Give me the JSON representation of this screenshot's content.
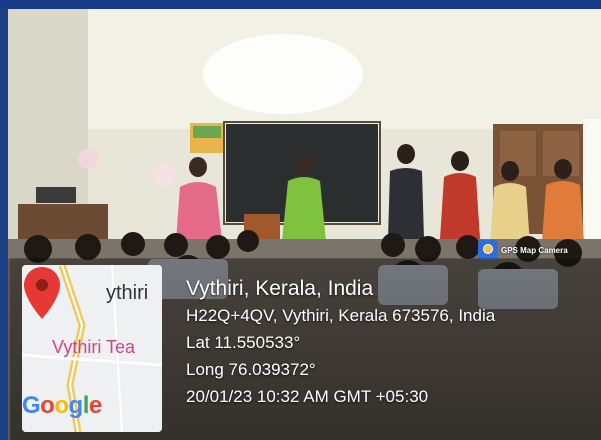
{
  "badge": {
    "label": "GPS Map Camera",
    "icon": "gps-map-camera-icon"
  },
  "map": {
    "place_primary": "ythiri",
    "place_secondary": "Vythiri Tea",
    "google": [
      "G",
      "o",
      "o",
      "g",
      "l",
      "e"
    ],
    "pin_icon": "map-pin-icon"
  },
  "location": {
    "title": "Vythiri, Kerala, India",
    "address": "H22Q+4QV, Vythiri, Kerala 673576, India",
    "latitude": "Lat 11.550533°",
    "longitude": "Long 76.039372°",
    "timestamp": "20/01/23 10:32 AM GMT +05:30"
  },
  "colors": {
    "frame": "#1c3f86",
    "pin": "#e53935",
    "map_road": "#f0c95f"
  }
}
